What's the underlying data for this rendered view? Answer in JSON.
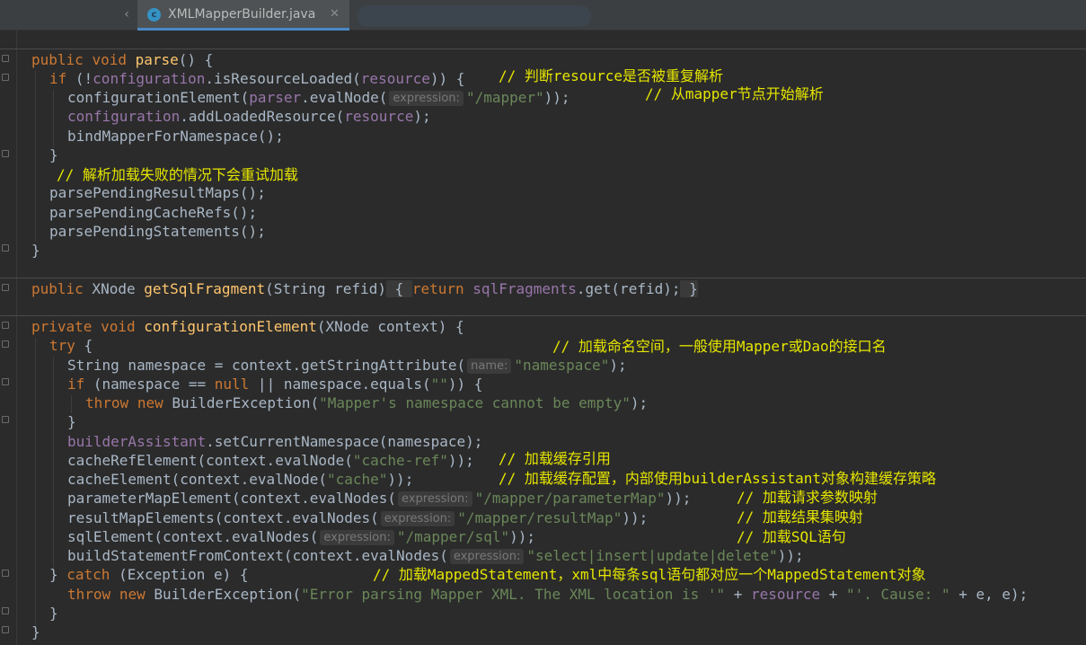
{
  "tab": {
    "file_name": "XMLMapperBuilder.java",
    "file_icon_letter": "c",
    "close_glyph": "✕",
    "scroll_left_glyph": "‹"
  },
  "icons": {
    "file": "java-class-icon",
    "close": "close-icon",
    "fold": "fold-marker-icon"
  },
  "colors": {
    "keyword": "#cc7832",
    "method": "#ffc66d",
    "field": "#9876aa",
    "string": "#6a8759",
    "comment": "#e6e600",
    "text": "#a9b7c6",
    "background": "#2b2b2b"
  },
  "code": {
    "l1": {
      "kw1": "public",
      "kw2": "void",
      "name": "parse",
      "rest": "() {"
    },
    "l2": {
      "kw": "if",
      "p1": " (!",
      "field": "configuration",
      "p2": ".isResourceLoaded(",
      "field2": "resource",
      "p3": ")) {",
      "comment": "// 判断resource是否被重复解析"
    },
    "l3": {
      "t1": "configurationElement(",
      "field": "parser",
      "t2": ".evalNode(",
      "hint": "expression:",
      "str": "\"/mapper\"",
      "t3": "));",
      "comment": "// 从mapper节点开始解析"
    },
    "l4": {
      "field": "configuration",
      "t1": ".addLoadedResource(",
      "field2": "resource",
      "t2": ");"
    },
    "l5": {
      "t1": "bindMapperForNamespace();"
    },
    "l6": {
      "t1": "}"
    },
    "l7": {
      "comment": "// 解析加载失败的情况下会重试加载"
    },
    "l8": {
      "t1": "parsePendingResultMaps();"
    },
    "l9": {
      "t1": "parsePendingCacheRefs();"
    },
    "l10": {
      "t1": "parsePendingStatements();"
    },
    "l11": {
      "t1": "}"
    },
    "l12": {
      "kw": "public",
      "t1": " XNode ",
      "name": "getSqlFragment",
      "t2": "(String refid)",
      "open": " { ",
      "kw2": "return",
      "field": "sqlFragments",
      "t3": ".get(refid);",
      "close": " }"
    },
    "l13": {
      "kw1": "private",
      "kw2": "void",
      "name": "configurationElement",
      "t1": "(XNode context) {"
    },
    "l14": {
      "kw": "try",
      "t1": " {",
      "comment": "// 加载命名空间，一般使用Mapper或Dao的接口名"
    },
    "l15": {
      "t1": "String namespace = context.getStringAttribute(",
      "hint": "name:",
      "str": "\"namespace\"",
      "t2": ");"
    },
    "l16": {
      "kw": "if",
      "t1": " (namespace == ",
      "kw2": "null",
      "t2": " || namespace.equals(",
      "str": "\"\"",
      "t3": ")) {"
    },
    "l17": {
      "kw": "throw",
      "kw2": "new",
      "t1": " BuilderException(",
      "str": "\"Mapper's namespace cannot be empty\"",
      "t2": ");"
    },
    "l18": {
      "t1": "}"
    },
    "l19": {
      "field": "builderAssistant",
      "t1": ".setCurrentNamespace(namespace);"
    },
    "l20": {
      "t1": "cacheRefElement(context.evalNode(",
      "str": "\"cache-ref\"",
      "t2": "));",
      "comment": "// 加载缓存引用"
    },
    "l21": {
      "t1": "cacheElement(context.evalNode(",
      "str": "\"cache\"",
      "t2": "));",
      "comment": "// 加载缓存配置，内部使用builderAssistant对象构建缓存策略"
    },
    "l22": {
      "t1": "parameterMapElement(context.evalNodes(",
      "hint": "expression:",
      "str": "\"/mapper/parameterMap\"",
      "t2": "));",
      "comment": "// 加载请求参数映射"
    },
    "l23": {
      "t1": "resultMapElements(context.evalNodes(",
      "hint": "expression:",
      "str": "\"/mapper/resultMap\"",
      "t2": "));",
      "comment": "// 加载结果集映射"
    },
    "l24": {
      "t1": "sqlElement(context.evalNodes(",
      "hint": "expression:",
      "str": "\"/mapper/sql\"",
      "t2": "));",
      "comment": "// 加载SQL语句"
    },
    "l25": {
      "t1": "buildStatementFromContext(context.evalNodes(",
      "hint": "expression:",
      "str": "\"select|insert|update|delete\"",
      "t2": "));"
    },
    "l26": {
      "t1": "} ",
      "kw": "catch",
      "t2": " (Exception e) {",
      "comment": "// 加载MappedStatement，xml中每条sql语句都对应一个MappedStatement对象"
    },
    "l27": {
      "kw": "throw",
      "kw2": "new",
      "t1": " BuilderException(",
      "str": "\"Error parsing Mapper XML. The XML location is '\"",
      "t2": " + ",
      "field": "resource",
      "t3": " + ",
      "str2": "\"'. Cause: \"",
      "t4": " + e, e);"
    },
    "l28": {
      "t1": "}"
    },
    "l29": {
      "t1": "}"
    }
  }
}
